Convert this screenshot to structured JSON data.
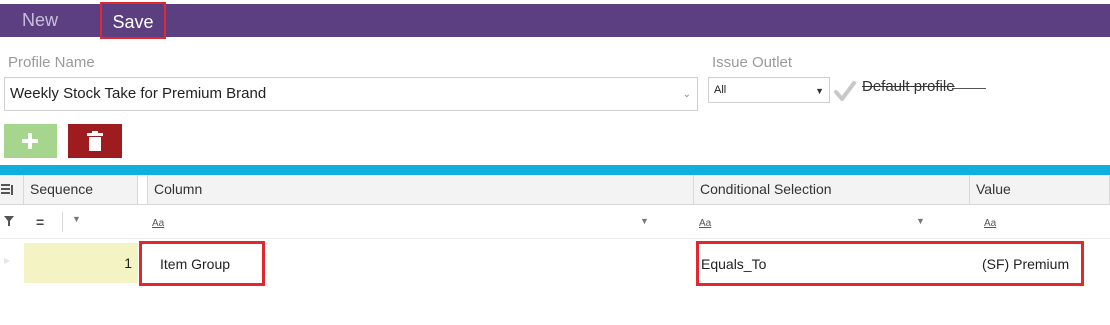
{
  "toolbar": {
    "new_label": "New",
    "save_label": "Save"
  },
  "form": {
    "profile_name_label": "Profile Name",
    "profile_name_value": "Weekly Stock Take for Premium Brand",
    "issue_outlet_label": "Issue Outlet",
    "issue_outlet_value": "All",
    "default_profile_label": "Default profile"
  },
  "grid": {
    "columns": [
      "Sequence",
      "Column",
      "Conditional Selection",
      "Value"
    ],
    "filter": {
      "equals_symbol": "=",
      "text_filter_icon": "Aa"
    },
    "rows": [
      {
        "sequence": "1",
        "column": "Item Group",
        "conditional_selection": "Equals_To",
        "value": "(SF) Premium"
      }
    ]
  },
  "colors": {
    "topbar": "#5b3f81",
    "accent": "#0fb0df",
    "add": "#a6d58d",
    "delete": "#9e1b1f",
    "highlight": "#e0282e"
  }
}
